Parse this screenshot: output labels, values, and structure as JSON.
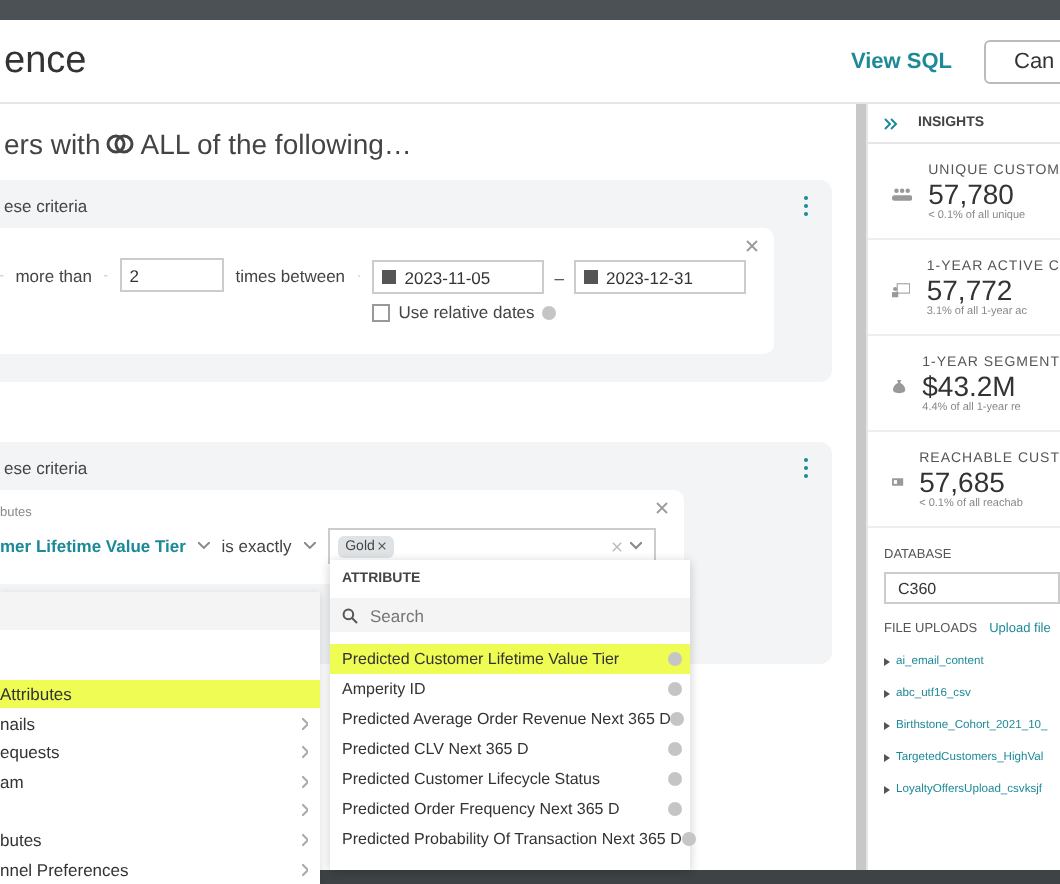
{
  "header": {
    "title": "ence",
    "actions": [
      {
        "kind": "link",
        "label": "View SQL"
      },
      {
        "kind": "button",
        "label": "Can"
      }
    ]
  },
  "segment": {
    "lead": "ers with",
    "operator": "ALL of the following…"
  },
  "groups": [
    {
      "caption": "ese criteria",
      "kind": "event",
      "row": {
        "comparator": "more than",
        "count": "2",
        "range_op": "times between",
        "start": "2023-11-05",
        "separator": "–",
        "end": "2023-12-31",
        "relative_label": "Use relative dates",
        "relative_checked": false
      }
    },
    {
      "caption": "ese criteria",
      "kind": "attribute",
      "row": {
        "source": "butes",
        "attribute": "mer Lifetime Value Tier",
        "op": "is exactly",
        "tags": [
          "Gold"
        ]
      }
    }
  ],
  "category_menu": {
    "items": [
      {
        "label": "Attributes",
        "selected": true,
        "has_submenu": false
      },
      {
        "label": "nails",
        "selected": false,
        "has_submenu": true
      },
      {
        "label": "equests",
        "selected": false,
        "has_submenu": true
      },
      {
        "label": "am",
        "selected": false,
        "has_submenu": true
      },
      {
        "selected": false,
        "has_submenu": true
      },
      {
        "label": "butes",
        "selected": false,
        "has_submenu": true
      },
      {
        "label": "nnel Preferences",
        "selected": false,
        "has_submenu": true
      }
    ]
  },
  "attribute_menu": {
    "heading": "ATTRIBUTE",
    "placeholder": "Search",
    "items": [
      {
        "label": "Predicted Customer Lifetime Value Tier",
        "selected": true
      },
      {
        "label": "Amperity ID",
        "selected": false
      },
      {
        "label": "Predicted Average Order Revenue Next 365 D",
        "selected": false
      },
      {
        "label": "Predicted CLV Next 365 D",
        "selected": false
      },
      {
        "label": "Predicted Customer Lifecycle Status",
        "selected": false
      },
      {
        "label": "Predicted Order Frequency Next 365 D",
        "selected": false
      },
      {
        "label": "Predicted Probability Of Transaction Next 365 D",
        "selected": false
      }
    ]
  },
  "insights": {
    "title": "INSIGHTS",
    "metrics": [
      {
        "kind": "people",
        "label": "UNIQUE CUSTOM",
        "value": "57,780",
        "note": "< 0.1% of all unique"
      },
      {
        "kind": "active",
        "label": "1-YEAR ACTIVE C",
        "value": "57,772",
        "note": "3.1% of all 1-year ac"
      },
      {
        "kind": "money",
        "label": "1-YEAR SEGMENT",
        "value": "$43.2M",
        "note": "4.4% of all 1-year re"
      },
      {
        "kind": "card",
        "label": "REACHABLE CUST",
        "value": "57,685",
        "note": "< 0.1% of all reachab"
      }
    ],
    "database_label": "DATABASE",
    "database": "C360",
    "uploads_label": "FILE UPLOADS",
    "upload_link": "Upload file",
    "files": [
      "ai_email_content",
      "abc_utf16_csv",
      "Birthstone_Cohort_2021_10_",
      "TargetedCustomers_HighVal",
      "LoyaltyOffersUpload_csvksjf"
    ]
  }
}
